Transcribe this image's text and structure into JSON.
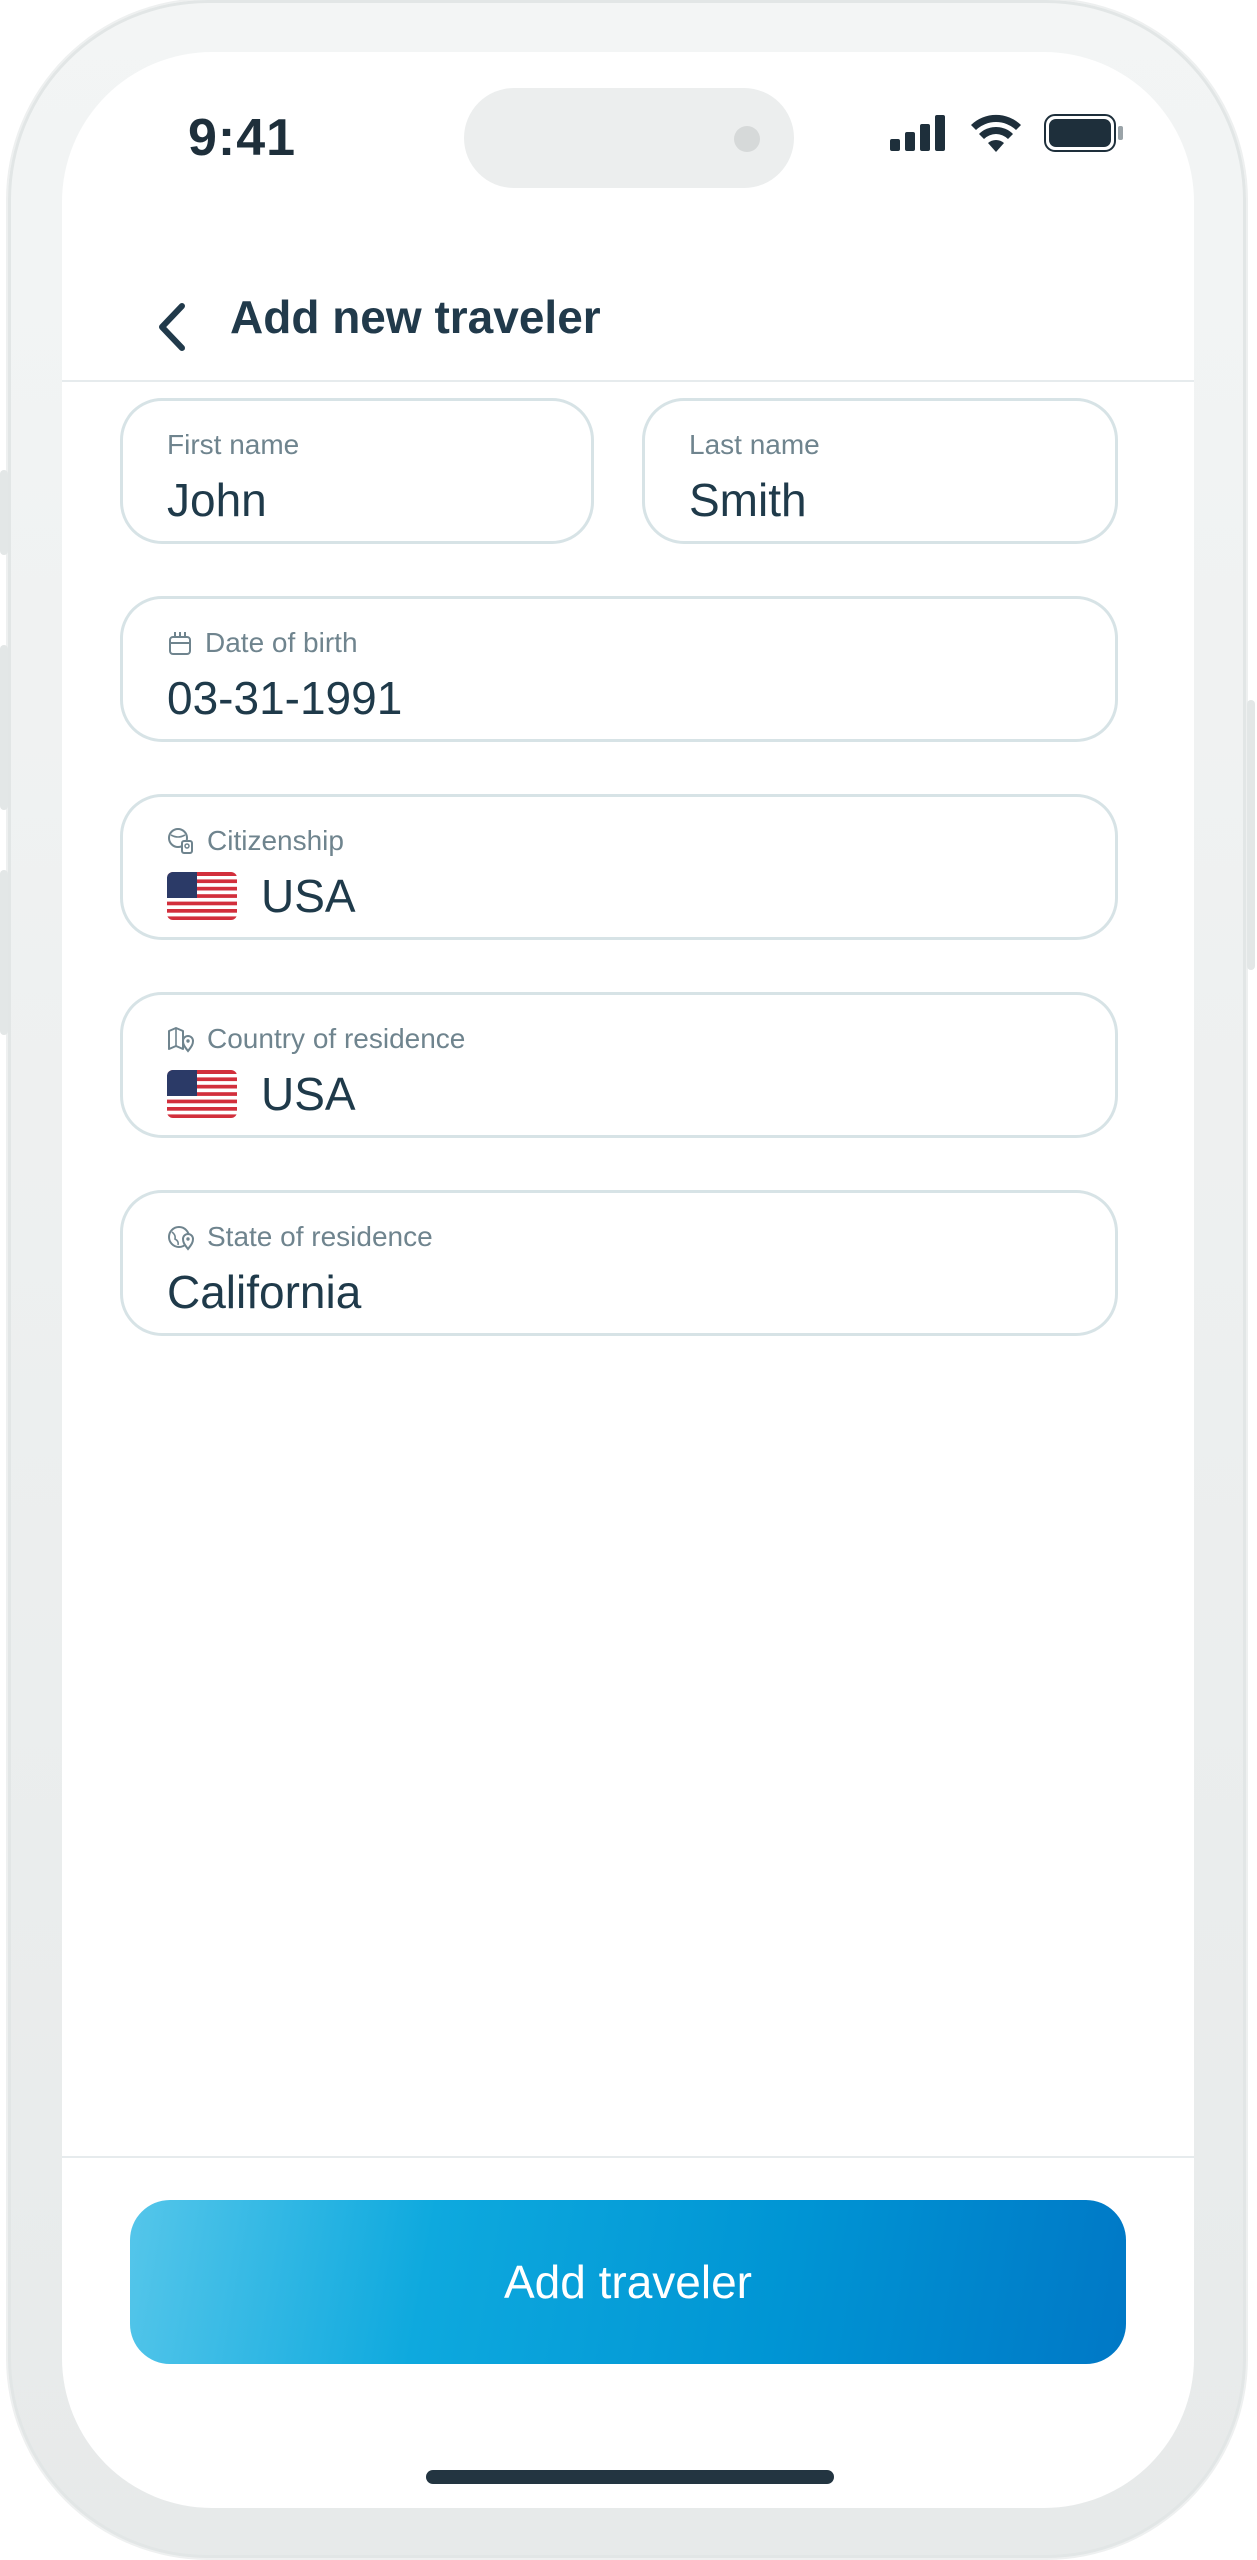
{
  "status_bar": {
    "time": "9:41"
  },
  "header": {
    "title": "Add new traveler"
  },
  "form": {
    "first_name": {
      "label": "First name",
      "value": "John"
    },
    "last_name": {
      "label": "Last name",
      "value": "Smith"
    },
    "date_of_birth": {
      "label": "Date of birth",
      "value": "03-31-1991",
      "icon": "calendar-icon"
    },
    "citizenship": {
      "label": "Citizenship",
      "value": "USA",
      "icon": "passport-globe-icon",
      "flag": "us-flag-icon"
    },
    "country_of_residence": {
      "label": "Country of residence",
      "value": "USA",
      "icon": "map-pin-icon",
      "flag": "us-flag-icon"
    },
    "state_of_residence": {
      "label": "State of residence",
      "value": "California",
      "icon": "globe-pin-icon"
    }
  },
  "actions": {
    "add_button": "Add traveler"
  },
  "colors": {
    "accent_start": "#55c6ea",
    "accent_end": "#0078c6",
    "text": "#1f3a4a",
    "border": "#d7e3e6"
  }
}
